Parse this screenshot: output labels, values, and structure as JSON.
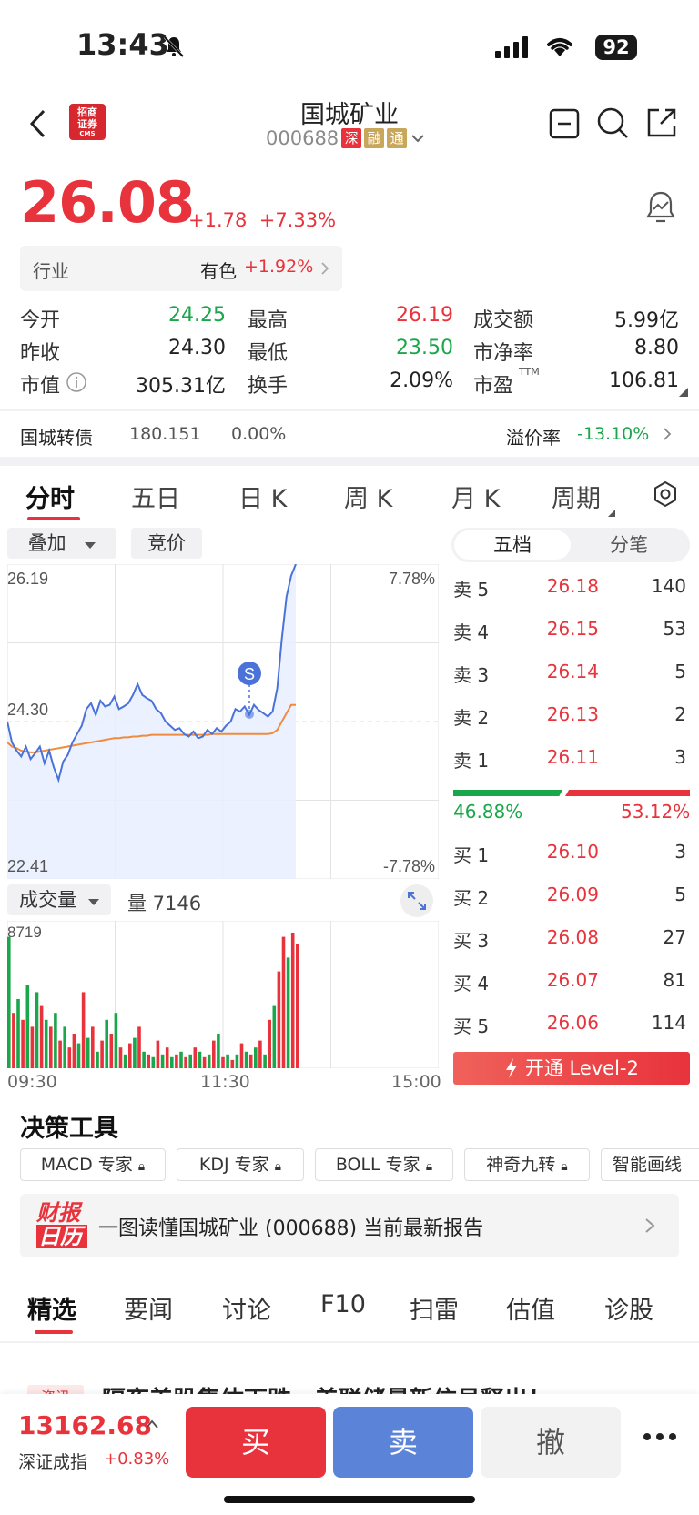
{
  "status": {
    "time": "13:43",
    "battery": "92"
  },
  "header": {
    "broker_logo_text": "招商证券",
    "broker_logo_sub": "CMS",
    "title": "国城矿业",
    "code": "000688",
    "tags": [
      "深",
      "融",
      "通"
    ]
  },
  "quote": {
    "price": "26.08",
    "change": "+1.78",
    "change_pct": "+7.33%",
    "industry_label": "行业",
    "industry_name": "有色",
    "industry_pct": "+1.92%"
  },
  "stats": {
    "open_label": "今开",
    "open": "24.25",
    "high_label": "最高",
    "high": "26.19",
    "turnover_amt_label": "成交额",
    "turnover_amt": "5.99亿",
    "prev_close_label": "昨收",
    "prev_close": "24.30",
    "low_label": "最低",
    "low": "23.50",
    "pb_label": "市净率",
    "pb": "8.80",
    "mktcap_label": "市值",
    "mktcap": "305.31亿",
    "turnover_label": "换手",
    "turnover": "2.09%",
    "pe_label": "市盈",
    "pe_sup": "TTM",
    "pe": "106.81"
  },
  "bond": {
    "name": "国城转债",
    "price": "180.151",
    "pct": "0.00%",
    "premium_label": "溢价率",
    "premium": "-13.10%"
  },
  "chart_tabs": [
    "分时",
    "五日",
    "日 K",
    "周 K",
    "月 K",
    "周期"
  ],
  "chart_controls": {
    "overlay": "叠加",
    "auction": "竞价",
    "volume_selector": "成交量",
    "volume_label": "量 7146"
  },
  "chart_data": {
    "type": "line",
    "price_axis": {
      "top": "26.19",
      "mid": "24.30",
      "bottom": "22.41"
    },
    "pct_axis": {
      "top": "7.78%",
      "bottom": "-7.78%"
    },
    "volume_max": "8719",
    "x_labels": [
      "09:30",
      "11:30",
      "15:00"
    ],
    "marker": "S",
    "series": [
      {
        "values": [
          24.3,
          24.05,
          23.95,
          23.88,
          24.0,
          23.85,
          23.92,
          24.0,
          23.8,
          23.95,
          23.75,
          23.6,
          23.82,
          23.9,
          24.05,
          24.15,
          24.25,
          24.45,
          24.52,
          24.38,
          24.55,
          24.48,
          24.5,
          24.6,
          24.45,
          24.48,
          24.52,
          24.62,
          24.75,
          24.62,
          24.58,
          24.55,
          24.45,
          24.4,
          24.3,
          24.25,
          24.2,
          24.22,
          24.15,
          24.12,
          24.18,
          24.1,
          24.12,
          24.2,
          24.15,
          24.22,
          24.18,
          24.25,
          24.3,
          24.45,
          24.42,
          24.48,
          24.38,
          24.5,
          24.44,
          24.4,
          24.36,
          24.42,
          24.7,
          25.3,
          25.8,
          26.05,
          26.19
        ]
      },
      {
        "values": [
          24.05,
          24.0,
          23.98,
          23.95,
          23.94,
          23.93,
          23.93,
          23.94,
          23.95,
          23.96,
          23.97,
          23.98,
          23.99,
          24.0,
          24.01,
          24.02,
          24.03,
          24.04,
          24.05,
          24.06,
          24.07,
          24.08,
          24.09,
          24.1,
          24.1,
          24.11,
          24.11,
          24.12,
          24.12,
          24.13,
          24.13,
          24.14,
          24.14,
          24.14,
          24.14,
          24.14,
          24.14,
          24.14,
          24.14,
          24.14,
          24.14,
          24.14,
          24.14,
          24.14,
          24.15,
          24.15,
          24.15,
          24.15,
          24.15,
          24.15,
          24.15,
          24.15,
          24.15,
          24.15,
          24.15,
          24.15,
          24.15,
          24.16,
          24.2,
          24.3,
          24.4,
          24.5,
          24.5
        ]
      }
    ],
    "volume": [
      0.95,
      0.4,
      0.5,
      0.35,
      0.6,
      0.3,
      0.55,
      0.45,
      0.35,
      0.3,
      0.4,
      0.2,
      0.3,
      0.15,
      0.25,
      0.18,
      0.55,
      0.22,
      0.3,
      0.12,
      0.2,
      0.35,
      0.25,
      0.4,
      0.15,
      0.1,
      0.18,
      0.22,
      0.3,
      0.12,
      0.1,
      0.08,
      0.2,
      0.1,
      0.15,
      0.08,
      0.1,
      0.12,
      0.08,
      0.1,
      0.15,
      0.12,
      0.08,
      0.1,
      0.2,
      0.25,
      0.08,
      0.1,
      0.06,
      0.1,
      0.18,
      0.12,
      0.1,
      0.15,
      0.2,
      0.1,
      0.35,
      0.45,
      0.7,
      0.95,
      0.8,
      0.98,
      0.9
    ],
    "volume_colors": [
      "g",
      "r",
      "g",
      "r",
      "g",
      "r",
      "g",
      "r",
      "g",
      "r",
      "g",
      "r",
      "g",
      "r",
      "r",
      "g",
      "r",
      "g",
      "r",
      "g",
      "r",
      "g",
      "r",
      "g",
      "r",
      "g",
      "r",
      "g",
      "r",
      "g",
      "r",
      "g",
      "r",
      "g",
      "r",
      "g",
      "r",
      "g",
      "r",
      "g",
      "r",
      "g",
      "r",
      "g",
      "r",
      "g",
      "r",
      "g",
      "r",
      "g",
      "r",
      "g",
      "r",
      "g",
      "r",
      "g",
      "r",
      "g",
      "r",
      "r",
      "g",
      "r",
      "r"
    ]
  },
  "orderbook": {
    "tab_depth": "五档",
    "tab_ticks": "分笔",
    "asks": [
      {
        "label": "卖 5",
        "price": "26.18",
        "vol": "140"
      },
      {
        "label": "卖 4",
        "price": "26.15",
        "vol": "53"
      },
      {
        "label": "卖 3",
        "price": "26.14",
        "vol": "5"
      },
      {
        "label": "卖 2",
        "price": "26.13",
        "vol": "2"
      },
      {
        "label": "卖 1",
        "price": "26.11",
        "vol": "3"
      }
    ],
    "buy_ratio": "46.88%",
    "sell_ratio": "53.12%",
    "bids": [
      {
        "label": "买 1",
        "price": "26.10",
        "vol": "3"
      },
      {
        "label": "买 2",
        "price": "26.09",
        "vol": "5"
      },
      {
        "label": "买 3",
        "price": "26.08",
        "vol": "27"
      },
      {
        "label": "买 4",
        "price": "26.07",
        "vol": "81"
      },
      {
        "label": "买 5",
        "price": "26.06",
        "vol": "114"
      }
    ],
    "level2_button": "开通 Level-2"
  },
  "tools": {
    "title": "决策工具",
    "items": [
      "MACD 专家",
      "KDJ 专家",
      "BOLL 专家",
      "神奇九转",
      "智能画线"
    ]
  },
  "report": {
    "logo_top": "财报",
    "logo_bottom": "日历",
    "text": "一图读懂国城矿业 (000688) 当前最新报告"
  },
  "news_tabs": [
    "精选",
    "要闻",
    "讨论",
    "F10",
    "扫雷",
    "估值",
    "诊股"
  ],
  "news_peek": {
    "badge": "资讯",
    "text": "隔夜美股集体下跌，美联储最新信号释出！"
  },
  "bottom": {
    "index_value": "13162.68",
    "index_name": "深证成指",
    "index_pct": "+0.83%",
    "buy": "买",
    "sell": "卖",
    "cancel": "撤"
  }
}
